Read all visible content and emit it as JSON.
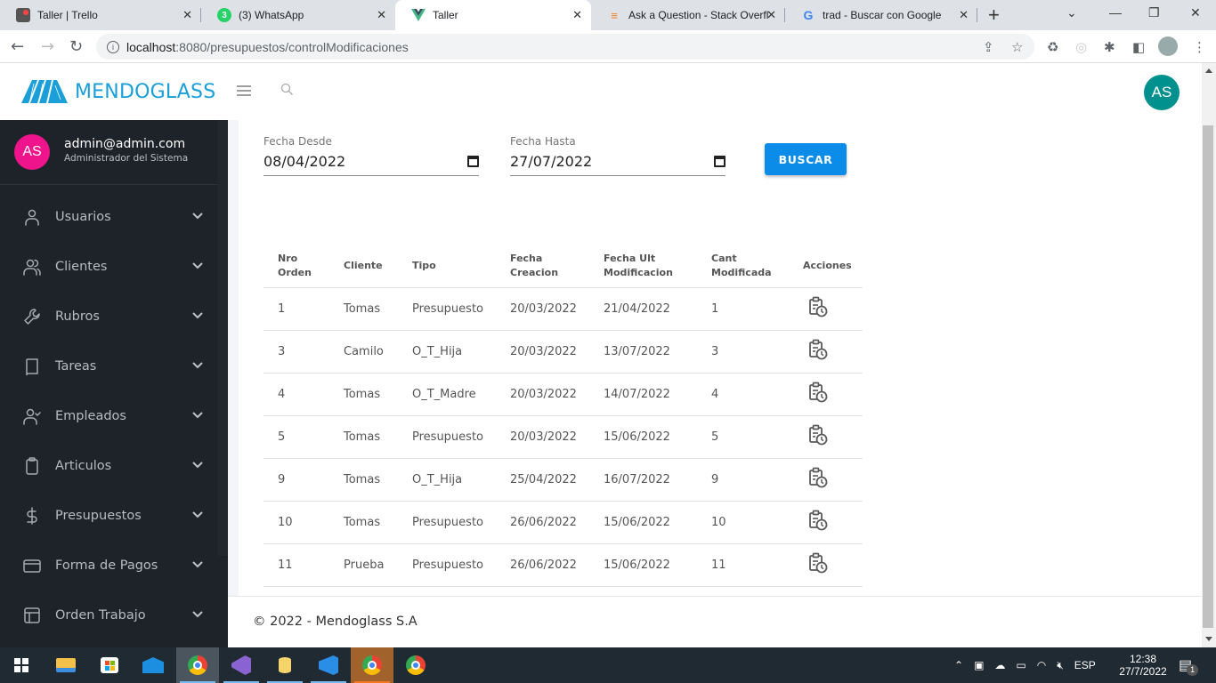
{
  "browser": {
    "tabs": [
      {
        "title": "Taller | Trello",
        "icon": "trello-icon",
        "active": false
      },
      {
        "title": "(3) WhatsApp",
        "icon": "whatsapp-icon",
        "badge": "3",
        "active": false
      },
      {
        "title": "Taller",
        "icon": "vue-icon",
        "active": true
      },
      {
        "title": "Ask a Question - Stack Overfl",
        "icon": "stackoverflow-icon",
        "active": false
      },
      {
        "title": "trad - Buscar con Google",
        "icon": "google-icon",
        "active": false
      }
    ],
    "url_host": "localhost",
    "url_path": ":8080/presupuestos/controlModificaciones"
  },
  "header": {
    "brand": "MENDOGLASS",
    "avatar_initials": "AS"
  },
  "sidebar": {
    "user": {
      "initials": "AS",
      "email": "admin@admin.com",
      "role": "Administrador del Sistema"
    },
    "items": [
      {
        "label": "Usuarios",
        "icon": "user-icon"
      },
      {
        "label": "Clientes",
        "icon": "users-icon"
      },
      {
        "label": "Rubros",
        "icon": "wrench-icon"
      },
      {
        "label": "Tareas",
        "icon": "book-icon"
      },
      {
        "label": "Empleados",
        "icon": "user-check-icon"
      },
      {
        "label": "Articulos",
        "icon": "clipboard-icon"
      },
      {
        "label": "Presupuestos",
        "icon": "dollar-icon"
      },
      {
        "label": "Forma de Pagos",
        "icon": "credit-card-icon"
      },
      {
        "label": "Orden Trabajo",
        "icon": "layout-icon"
      }
    ]
  },
  "filters": {
    "fecha_desde": {
      "label": "Fecha Desde",
      "value": "08/04/2022"
    },
    "fecha_hasta": {
      "label": "Fecha Hasta",
      "value": "27/07/2022"
    },
    "search_button": "BUSCAR"
  },
  "table": {
    "headers": [
      [
        "Nro",
        "Orden"
      ],
      [
        "Cliente"
      ],
      [
        "Tipo"
      ],
      [
        "Fecha",
        "Creacion"
      ],
      [
        "Fecha Ult",
        "Modificacion"
      ],
      [
        "Cant",
        "Modificada"
      ],
      [
        "Acciones"
      ]
    ],
    "rows": [
      {
        "nro": "1",
        "cliente": "Tomas",
        "tipo": "Presupuesto",
        "creacion": "20/03/2022",
        "ult_mod": "21/04/2022",
        "cant": "1"
      },
      {
        "nro": "3",
        "cliente": "Camilo",
        "tipo": "O_T_Hija",
        "creacion": "20/03/2022",
        "ult_mod": "13/07/2022",
        "cant": "3"
      },
      {
        "nro": "4",
        "cliente": "Tomas",
        "tipo": "O_T_Madre",
        "creacion": "20/03/2022",
        "ult_mod": "14/07/2022",
        "cant": "4"
      },
      {
        "nro": "5",
        "cliente": "Tomas",
        "tipo": "Presupuesto",
        "creacion": "20/03/2022",
        "ult_mod": "15/06/2022",
        "cant": "5"
      },
      {
        "nro": "9",
        "cliente": "Tomas",
        "tipo": "O_T_Hija",
        "creacion": "25/04/2022",
        "ult_mod": "16/07/2022",
        "cant": "9"
      },
      {
        "nro": "10",
        "cliente": "Tomas",
        "tipo": "Presupuesto",
        "creacion": "26/06/2022",
        "ult_mod": "15/06/2022",
        "cant": "10"
      },
      {
        "nro": "11",
        "cliente": "Prueba",
        "tipo": "Presupuesto",
        "creacion": "26/06/2022",
        "ult_mod": "15/06/2022",
        "cant": "11"
      }
    ]
  },
  "footer": {
    "text": "© 2022 - Mendoglass S.A"
  },
  "taskbar": {
    "language": "ESP",
    "time": "12:38",
    "date": "27/7/2022",
    "notifications": "1"
  },
  "colors": {
    "brand": "#1a9fd8",
    "primary_button": "#0c8ce9",
    "sidebar_bg": "#1e2229",
    "user_avatar": "#f0148c",
    "header_avatar": "#00918e"
  }
}
